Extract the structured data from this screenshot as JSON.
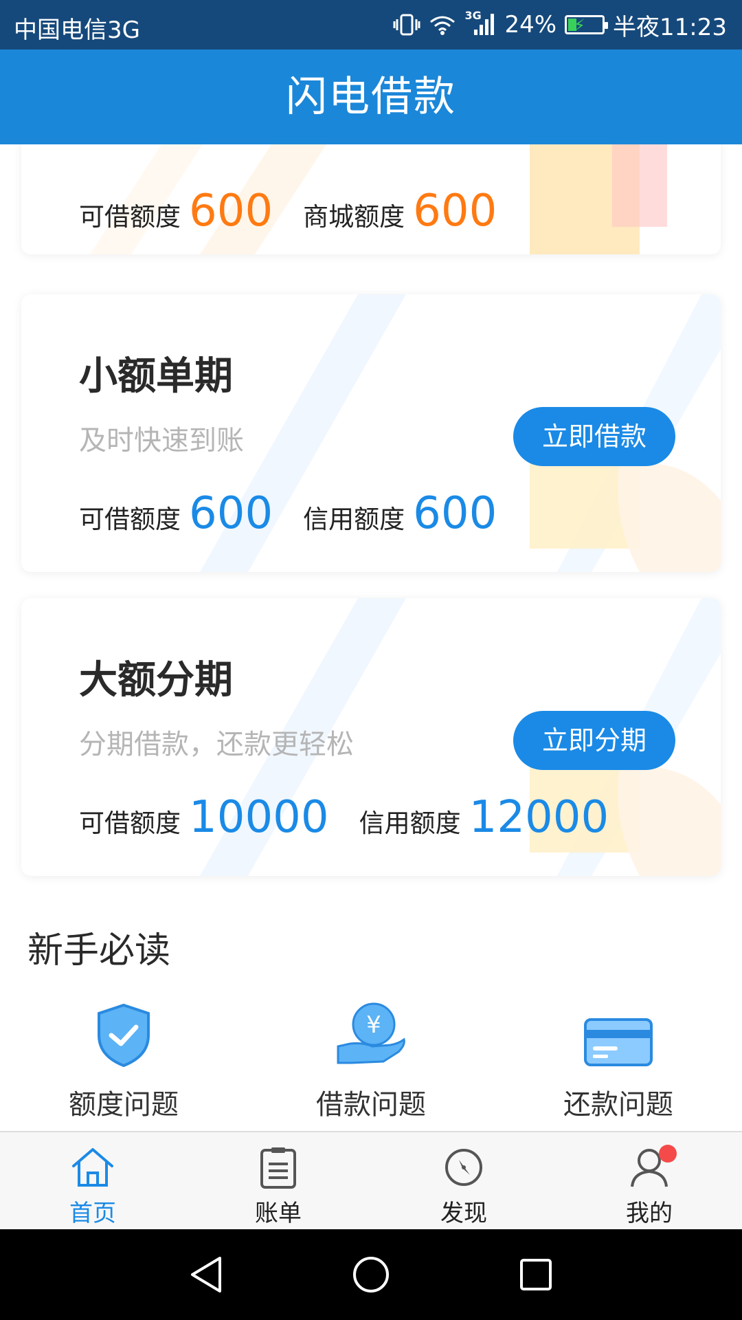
{
  "status_bar": {
    "carrier": "中国电信3G",
    "network": "3G",
    "battery": "24%",
    "battery_level": 0.24,
    "time": "半夜11:23"
  },
  "header": {
    "title": "闪电借款"
  },
  "cards": [
    {
      "amounts": [
        {
          "label": "可借额度",
          "value": "600"
        },
        {
          "label": "商城额度",
          "value": "600"
        }
      ],
      "accent": "#ff7a12"
    },
    {
      "title": "小额单期",
      "subtitle": "及时快速到账",
      "button": "立即借款",
      "amounts": [
        {
          "label": "可借额度",
          "value": "600"
        },
        {
          "label": "信用额度",
          "value": "600"
        }
      ],
      "accent": "#1a8ae6"
    },
    {
      "title": "大额分期",
      "subtitle": "分期借款，还款更轻松",
      "button": "立即分期",
      "amounts": [
        {
          "label": "可借额度",
          "value": "10000"
        },
        {
          "label": "信用额度",
          "value": "12000"
        }
      ],
      "accent": "#1a8ae6"
    }
  ],
  "guide": {
    "title": "新手必读",
    "items": [
      {
        "label": "额度问题",
        "icon": "shield-check-icon"
      },
      {
        "label": "借款问题",
        "icon": "hand-coin-icon"
      },
      {
        "label": "还款问题",
        "icon": "credit-card-icon"
      }
    ]
  },
  "bottom_nav": {
    "items": [
      {
        "label": "首页",
        "icon": "home-icon",
        "active": true
      },
      {
        "label": "账单",
        "icon": "bill-icon",
        "active": false
      },
      {
        "label": "发现",
        "icon": "compass-icon",
        "active": false
      },
      {
        "label": "我的",
        "icon": "user-icon",
        "active": false,
        "badge": true
      }
    ]
  },
  "system_nav": [
    "back-icon",
    "home-circle-icon",
    "recents-icon"
  ],
  "colors": {
    "status_bar": "#16497b",
    "header": "#1b87d9",
    "primary": "#1a8ae6",
    "orange": "#ff7a12",
    "badge": "#f54a4a"
  }
}
